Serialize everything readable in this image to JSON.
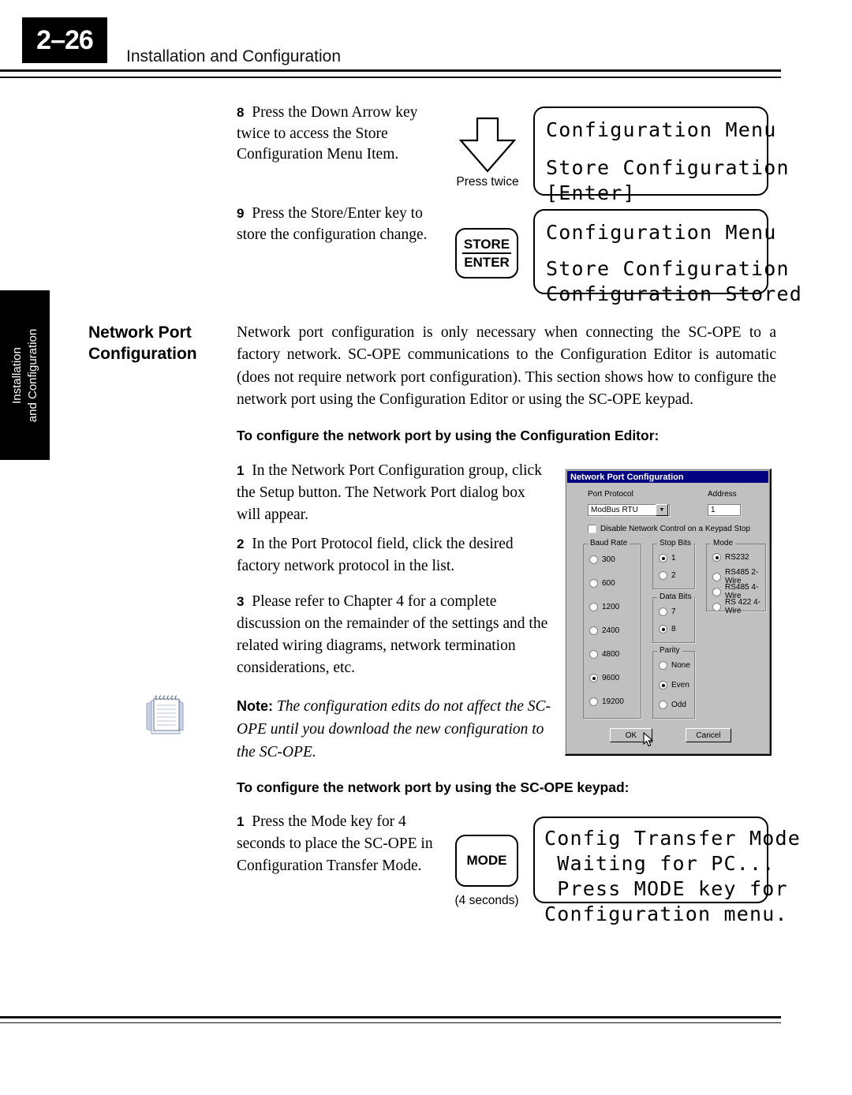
{
  "header": {
    "page_number": "2–26",
    "title": "Installation and Configuration"
  },
  "side_tab": {
    "line1": "Installation",
    "line2": "and Configuration"
  },
  "steps_top": [
    {
      "num": "8",
      "text": "Press the Down Arrow key twice to access the Store Configuration Menu Item."
    },
    {
      "num": "9",
      "text": "Press the Store/Enter key to store the configuration change."
    }
  ],
  "arrow_caption": "Press twice",
  "store_key": {
    "line1": "STORE",
    "line2": "ENTER"
  },
  "lcd_top": {
    "line1": "Configuration Menu",
    "line2": "Store Configuration",
    "line3": "[Enter]"
  },
  "lcd_second": {
    "line1": "Configuration Menu",
    "line2": "Store Configuration",
    "line3": "Configuration Stored"
  },
  "section": {
    "title_line1": "Network Port",
    "title_line2": "Configuration",
    "paragraph": "Network port configuration is only necessary when connecting the SC-OPE to a factory network. SC-OPE communications to the Configuration Editor is automatic (does not require network port configuration). This section shows how to configure the network port using the Configuration Editor or using the SC-OPE keypad."
  },
  "heading_editor": "To configure the network port by using the Configuration Editor:",
  "steps_editor": [
    {
      "num": "1",
      "text": "In the Network Port Configuration group, click the Setup button. The Network Port dialog box will appear."
    },
    {
      "num": "2",
      "text": "In the Port Protocol field, click the desired factory network protocol in the list."
    },
    {
      "num": "3",
      "text": "Please refer to Chapter 4 for a complete discussion on the remainder of the settings and the related wiring diagrams, network termination considerations, etc."
    }
  ],
  "note": {
    "label": "Note:",
    "text": "The configuration edits do not affect the SC-OPE until you download the new configuration to the SC-OPE."
  },
  "heading_keypad": "To configure the network port by using the SC-OPE keypad:",
  "steps_keypad": [
    {
      "num": "1",
      "text": "Press the Mode key for 4 seconds to place the SC-OPE in Configuration Transfer Mode."
    }
  ],
  "mode_key": {
    "label": "MODE",
    "caption": "(4 seconds)"
  },
  "lcd_bottom": {
    "line1": "Config Transfer Mode",
    "line2": " Waiting for PC...",
    "line3": " Press MODE key for",
    "line4": "Configuration menu."
  },
  "dialog": {
    "title": "Network Port Configuration",
    "port_protocol_label": "Port Protocol",
    "port_protocol_value": "ModBus RTU",
    "address_label": "Address",
    "address_value": "1",
    "checkbox_label": "Disable Network Control on a Keypad Stop",
    "checkbox_checked": false,
    "baud_rate": {
      "title": "Baud Rate",
      "options": [
        "300",
        "600",
        "1200",
        "2400",
        "4800",
        "9600",
        "19200"
      ],
      "selected": "9600"
    },
    "stop_bits": {
      "title": "Stop Bits",
      "options": [
        "1",
        "2"
      ],
      "selected": "1"
    },
    "data_bits": {
      "title": "Data Bits",
      "options": [
        "7",
        "8"
      ],
      "selected": "8"
    },
    "parity": {
      "title": "Parity",
      "options": [
        "None",
        "Even",
        "Odd"
      ],
      "selected": "Even"
    },
    "mode": {
      "title": "Mode",
      "options": [
        "RS232",
        "RS485 2-Wire",
        "RS485 4-Wire",
        "RS 422 4-Wire"
      ],
      "selected": "RS232"
    },
    "ok_label": "OK",
    "cancel_label": "Cancel"
  },
  "colors": {
    "titlebar": "#000080",
    "dialog_face": "#c0c0c0",
    "ink": "#000000"
  }
}
